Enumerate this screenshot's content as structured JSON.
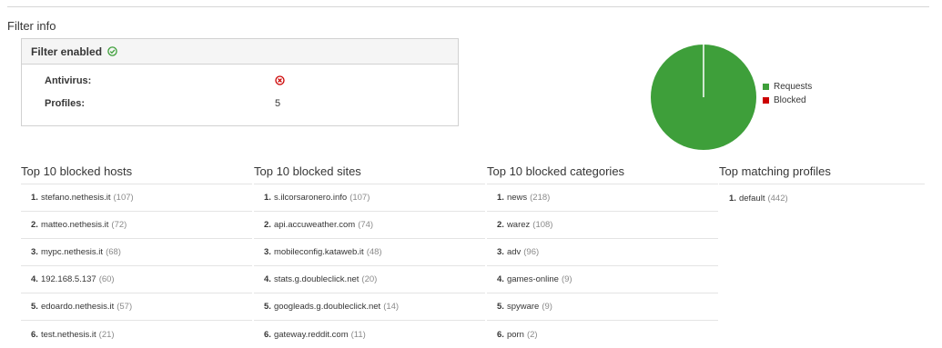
{
  "page_title": "Filter info",
  "filter": {
    "header": "Filter enabled",
    "antivirus_label": "Antivirus:",
    "profiles_label": "Profiles:",
    "profiles_value": "5"
  },
  "colors": {
    "requests": "#3e9f3a",
    "blocked": "#cc0000"
  },
  "chart_data": {
    "type": "pie",
    "series": [
      {
        "name": "Requests",
        "value": 100
      },
      {
        "name": "Blocked",
        "value": 0
      }
    ],
    "legend": "right"
  },
  "columns": [
    {
      "title": "Top 10 blocked hosts",
      "items": [
        {
          "num": "1.",
          "name": "stefano.nethesis.it",
          "count": "(107)"
        },
        {
          "num": "2.",
          "name": "matteo.nethesis.it",
          "count": "(72)"
        },
        {
          "num": "3.",
          "name": "mypc.nethesis.it",
          "count": "(68)"
        },
        {
          "num": "4.",
          "name": "192.168.5.137",
          "count": "(60)"
        },
        {
          "num": "5.",
          "name": "edoardo.nethesis.it",
          "count": "(57)"
        },
        {
          "num": "6.",
          "name": "test.nethesis.it",
          "count": "(21)"
        }
      ]
    },
    {
      "title": "Top 10 blocked sites",
      "items": [
        {
          "num": "1.",
          "name": "s.ilcorsaronero.info",
          "count": "(107)"
        },
        {
          "num": "2.",
          "name": "api.accuweather.com",
          "count": "(74)"
        },
        {
          "num": "3.",
          "name": "mobileconfig.kataweb.it",
          "count": "(48)"
        },
        {
          "num": "4.",
          "name": "stats.g.doubleclick.net",
          "count": "(20)"
        },
        {
          "num": "5.",
          "name": "googleads.g.doubleclick.net",
          "count": "(14)"
        },
        {
          "num": "6.",
          "name": "gateway.reddit.com",
          "count": "(11)"
        }
      ]
    },
    {
      "title": "Top 10 blocked categories",
      "items": [
        {
          "num": "1.",
          "name": "news",
          "count": "(218)"
        },
        {
          "num": "2.",
          "name": "warez",
          "count": "(108)"
        },
        {
          "num": "3.",
          "name": "adv",
          "count": "(96)"
        },
        {
          "num": "4.",
          "name": "games-online",
          "count": "(9)"
        },
        {
          "num": "5.",
          "name": "spyware",
          "count": "(9)"
        },
        {
          "num": "6.",
          "name": "porn",
          "count": "(2)"
        }
      ]
    },
    {
      "title": "Top matching profiles",
      "items": [
        {
          "num": "1.",
          "name": "default",
          "count": "(442)"
        }
      ]
    }
  ]
}
